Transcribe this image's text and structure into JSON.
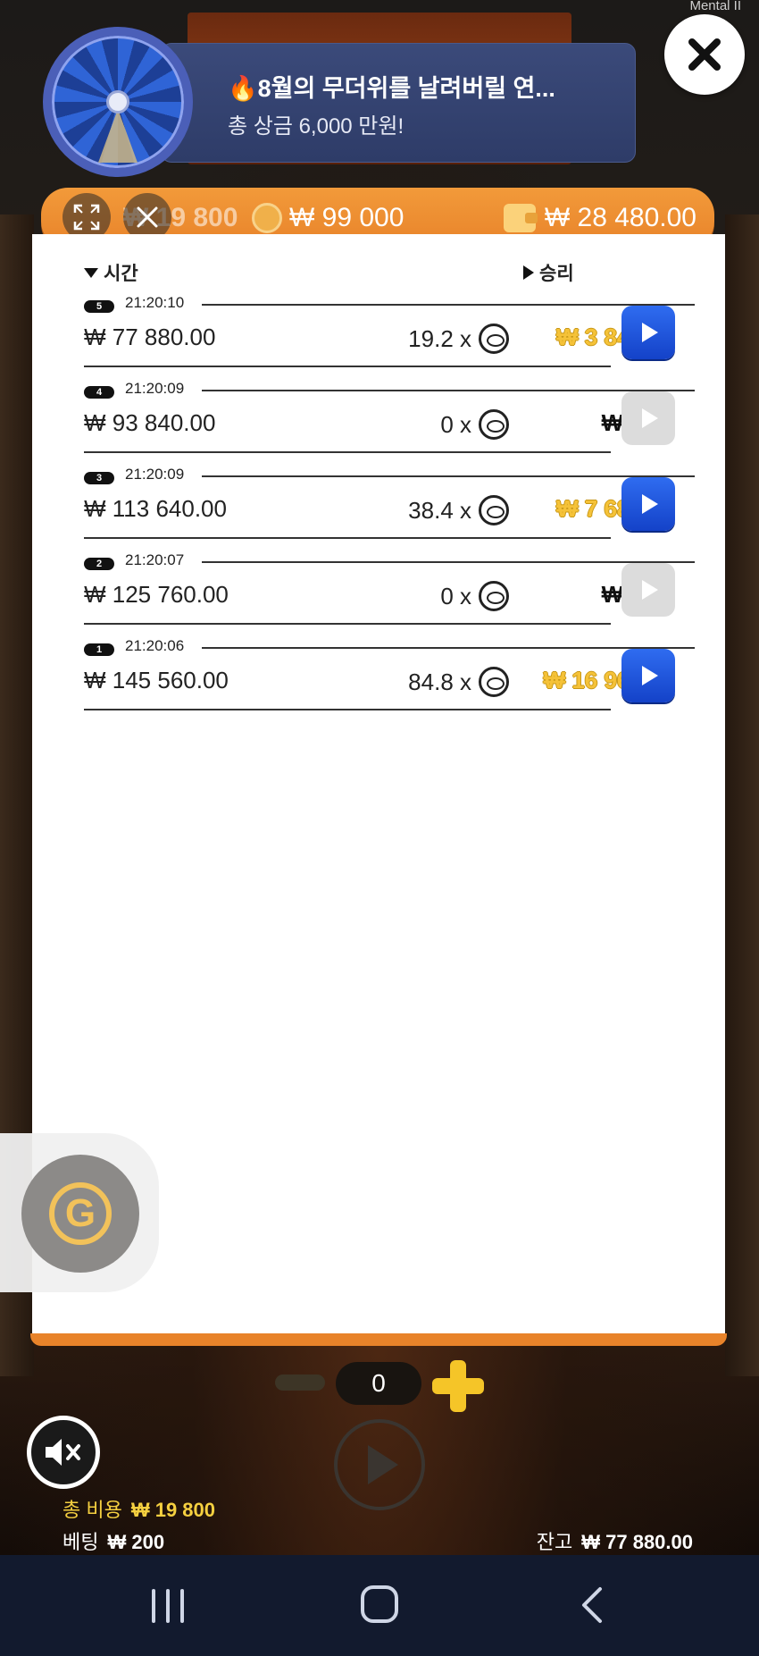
{
  "app": {
    "corner_label": "Mental II"
  },
  "promo": {
    "title": "🔥8월의 무더위를 날려버릴 연...",
    "subtitle": "총 상금 6,000 만원!",
    "banner_color": "#2e3c68"
  },
  "header": {
    "total_bet": "₩ 19 800",
    "coin_value": "₩ 99 000",
    "balance": "₩ 28 480.00",
    "color": "#e8832a"
  },
  "history": {
    "columns": {
      "time": "시간",
      "win": "승리"
    },
    "rows": [
      {
        "index": "5",
        "time": "21:20:10",
        "balance": "₩ 77 880.00",
        "multiplier": "19.2 x",
        "win": "₩ 3 840.00",
        "win_style": "gold",
        "replay_enabled": true
      },
      {
        "index": "4",
        "time": "21:20:09",
        "balance": "₩ 93 840.00",
        "multiplier": "0 x",
        "win": "₩ 0.00",
        "win_style": "plain",
        "replay_enabled": false
      },
      {
        "index": "3",
        "time": "21:20:09",
        "balance": "₩ 113 640.00",
        "multiplier": "38.4 x",
        "win": "₩ 7 680.00",
        "win_style": "gold",
        "replay_enabled": true
      },
      {
        "index": "2",
        "time": "21:20:07",
        "balance": "₩ 125 760.00",
        "multiplier": "0 x",
        "win": "₩ 0.00",
        "win_style": "plain",
        "replay_enabled": false
      },
      {
        "index": "1",
        "time": "21:20:06",
        "balance": "₩ 145 560.00",
        "multiplier": "84.8 x",
        "win": "₩ 16 960.00",
        "win_style": "gold",
        "replay_enabled": true
      }
    ]
  },
  "controls": {
    "bet_count": "0",
    "g_button_letter": "G",
    "accent_gold": "#f5c528"
  },
  "footer": {
    "total_cost_label": "총 비용",
    "total_cost_value": "₩ 19 800",
    "bet_label": "베팅",
    "bet_value": "₩ 200",
    "balance_label": "잔고",
    "balance_value": "₩ 77 880.00"
  },
  "icons": {
    "close": "close-icon",
    "expand": "expand-icon",
    "mute": "speaker-muted-icon",
    "coin": "coin-icon",
    "wallet": "wallet-icon",
    "play": "play-icon"
  }
}
